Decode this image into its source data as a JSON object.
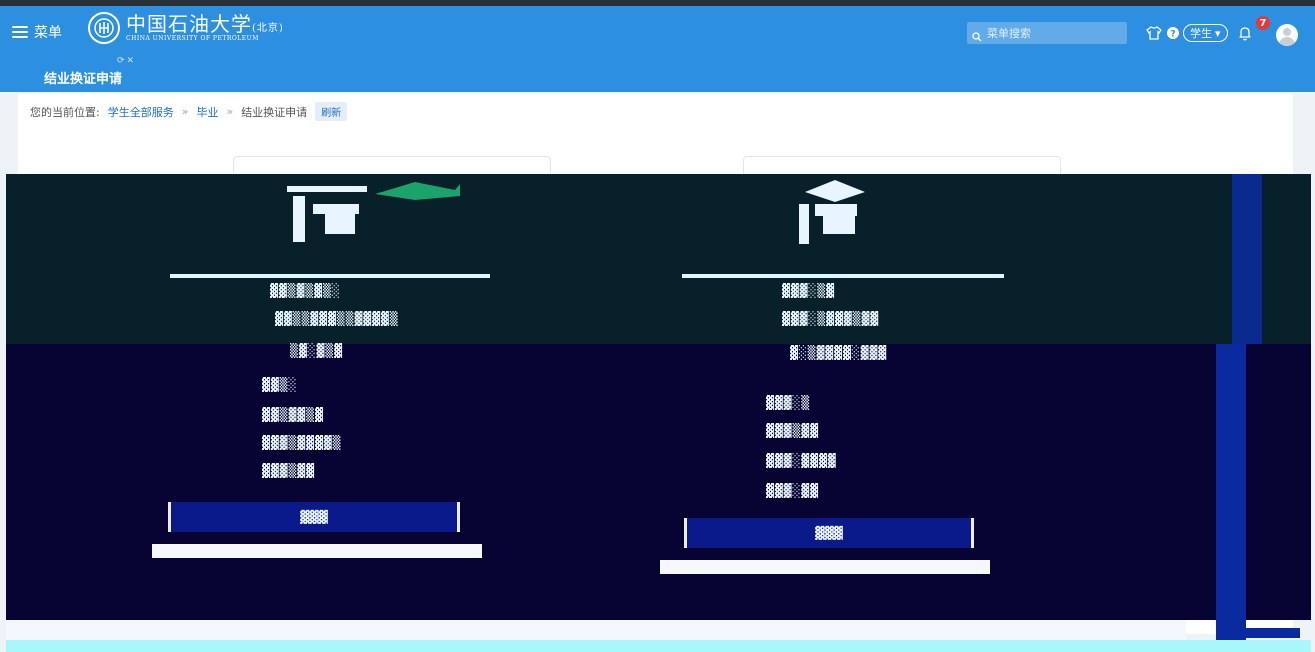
{
  "topbar": {
    "menu_label": "菜单",
    "logo_cn": "中国石油大学",
    "logo_cn_suffix": "(北京)",
    "logo_en": "CHINA UNIVERSITY OF PETROLEUM",
    "search_placeholder": "菜单搜索",
    "role_label": "学生",
    "notification_count": "7",
    "accent_color": "#2d8fe0"
  },
  "tabs": [
    {
      "label": "结业换证申请"
    }
  ],
  "breadcrumb": {
    "prefix": "您的当前位置:",
    "items": [
      "学生全部服务",
      "毕业",
      "结业换证申请"
    ],
    "separator": "»",
    "refresh_label": "刷新"
  }
}
